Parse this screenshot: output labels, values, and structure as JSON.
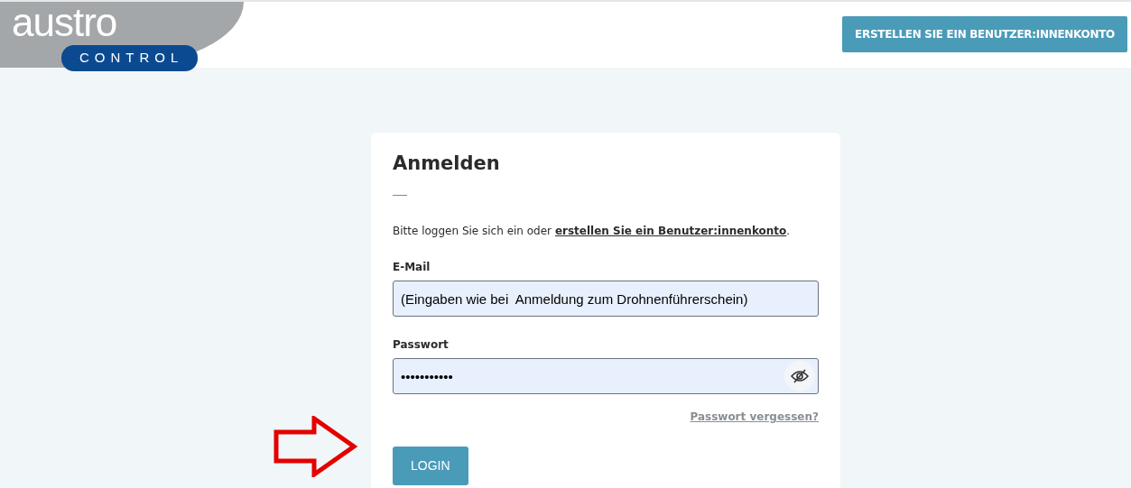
{
  "header": {
    "logo": {
      "word": "austro",
      "badge": "CONTROL"
    },
    "register_button": "ERSTELLEN SIE EIN BENUTZER:INNENKONTO"
  },
  "login_card": {
    "title": "Anmelden",
    "intro": {
      "text": "Bitte loggen Sie sich ein oder ",
      "link": "erstellen Sie ein Benutzer:innenkonto",
      "after": "."
    },
    "email": {
      "label": "E-Mail",
      "value": "(Eingaben wie bei  Anmeldung zum Drohnenführerschein)"
    },
    "password": {
      "label": "Passwort",
      "value": "•••••••••••"
    },
    "forgot_link": "Passwort vergessen?",
    "login_button": "LOGIN"
  }
}
